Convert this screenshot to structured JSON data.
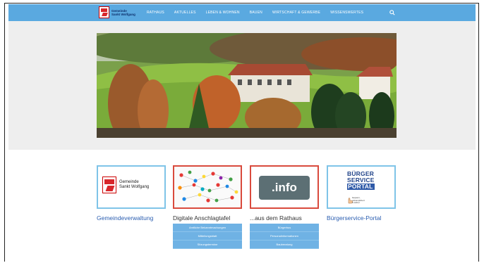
{
  "nav": {
    "logo_line1": "Gemeinde",
    "logo_line2": "Sankt Wolfgang",
    "items": [
      "RATHAUS",
      "AKTUELLES",
      "LEBEN & WOHNEN",
      "BAUEN",
      "WIRTSCHAFT & GEWERBE",
      "WISSENSWERTES"
    ]
  },
  "cards": [
    {
      "title": "Gemeindeverwaltung",
      "logo_line1": "Gemeinde",
      "logo_line2": "Sankt Wolfgang"
    },
    {
      "title": "Digitale Anschlagtafel",
      "submenu": [
        "Amtliche Bekanntmachungen",
        "Mitteilungsblatt",
        "Sitzungstermine"
      ]
    },
    {
      "title": "...aus dem Rathaus",
      "badge": ".info",
      "submenu": [
        "Bürgerbus",
        "Personalinformationen",
        "Bauberatung"
      ]
    },
    {
      "title": "Bürgerservice-Portal",
      "badge_lines": [
        "BÜRGER",
        "SERVICE",
        "PORTAL"
      ],
      "badge_small": [
        "bequem,",
        "unkompliziert",
        "& sicher"
      ]
    }
  ],
  "colors": {
    "navbar": "#5aa9e0",
    "link_blue": "#2a5db0",
    "accent_red": "#d94a3d",
    "submenu": "#6fb2e4"
  }
}
